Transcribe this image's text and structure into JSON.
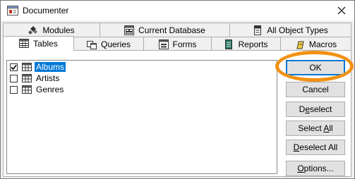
{
  "window": {
    "title": "Documenter"
  },
  "tabs": {
    "row_back": [
      {
        "label": "Modules",
        "icon": "modules-icon"
      },
      {
        "label": "Current Database",
        "icon": "current-database-icon"
      },
      {
        "label": "All Object Types",
        "icon": "all-object-types-icon"
      }
    ],
    "row_front": [
      {
        "label": "Tables",
        "icon": "table-icon",
        "selected": true
      },
      {
        "label": "Queries",
        "icon": "query-icon"
      },
      {
        "label": "Forms",
        "icon": "form-icon"
      },
      {
        "label": "Reports",
        "icon": "report-icon"
      },
      {
        "label": "Macros",
        "icon": "macro-icon"
      }
    ]
  },
  "list": {
    "items": [
      {
        "label": "Albums",
        "checked": true,
        "selected": true
      },
      {
        "label": "Artists",
        "checked": false,
        "selected": false
      },
      {
        "label": "Genres",
        "checked": false,
        "selected": false
      }
    ]
  },
  "buttons": {
    "ok": "OK",
    "cancel": "Cancel",
    "deselect": {
      "pre": "D",
      "u": "e",
      "post": "select"
    },
    "select_all": {
      "pre": "Select ",
      "u": "A",
      "post": "ll"
    },
    "deselect_all": {
      "pre": "",
      "u": "D",
      "post": "eselect All"
    },
    "options": {
      "pre": "",
      "u": "O",
      "post": "ptions..."
    }
  },
  "colors": {
    "accent": "#0078d7",
    "highlight_ring": "#f29111"
  }
}
